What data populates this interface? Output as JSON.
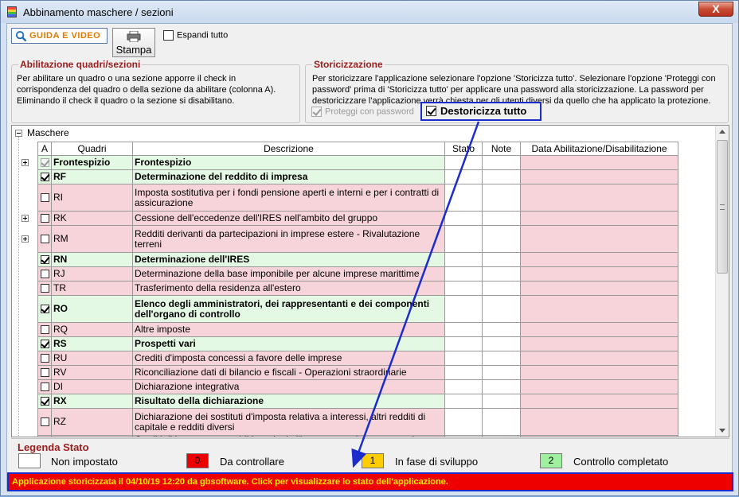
{
  "window": {
    "title": "Abbinamento maschere / sezioni",
    "close_label": "X"
  },
  "toolbar": {
    "guida_label": "GUIDA E VIDEO",
    "stampa_label": "Stampa",
    "espandi_label": "Espandi tutto",
    "espandi_checked": false
  },
  "abilitazione": {
    "title": "Abilitazione quadri/sezioni",
    "text": "Per abilitare un quadro o una sezione apporre il check in corrispondenza del quadro o della sezione da abilitare (colonna A). Eliminando il check il quadro o la sezione si disabilitano."
  },
  "storicizzazione": {
    "title": "Storicizzazione",
    "text": "Per storicizzare l'applicazione selezionare l'opzione 'Storicizza tutto'. Selezionare l'opzione 'Proteggi con password' prima di 'Storicizza tutto' per applicare una password alla storicizzazione. La password per destoricizzare l'applicazione verrà chiesta per gli utenti diversi da quello che ha applicato la protezione.",
    "proteggi_label": "Proteggi con password",
    "destoricizza_label": "Destoricizza tutto"
  },
  "tree": {
    "root_label": "Maschere",
    "columns": [
      "A",
      "Quadri",
      "Descrizione",
      "Stato",
      "Note",
      "Data Abilitazione/Disabilitazione"
    ],
    "rows": [
      {
        "code": "Frontespizio",
        "desc": "Frontespizio",
        "checked": true,
        "disabled": true,
        "style": "green",
        "expander": true,
        "tall": false
      },
      {
        "code": "RF",
        "desc": "Determinazione del reddito di impresa",
        "checked": true,
        "style": "green",
        "expander": false,
        "tall": false
      },
      {
        "code": "RI",
        "desc": "Imposta sostitutiva per i fondi pensione aperti e interni e per i contratti di assicurazione",
        "checked": false,
        "style": "pink",
        "expander": false,
        "tall": true
      },
      {
        "code": "RK",
        "desc": "Cessione dell'eccedenze dell'IRES nell'ambito del gruppo",
        "checked": false,
        "style": "pink",
        "expander": true,
        "tall": false
      },
      {
        "code": "RM",
        "desc": "Redditi derivanti da  partecipazioni in imprese estere - Rivalutazione terreni",
        "checked": false,
        "style": "pink",
        "expander": true,
        "tall": true
      },
      {
        "code": "RN",
        "desc": "Determinazione dell'IRES",
        "checked": true,
        "style": "green",
        "expander": false,
        "tall": false
      },
      {
        "code": "RJ",
        "desc": "Determinazione della base imponibile per alcune imprese marittime",
        "checked": false,
        "style": "pink",
        "expander": false,
        "tall": false
      },
      {
        "code": "TR",
        "desc": "Trasferimento della residenza all'estero",
        "checked": false,
        "style": "pink",
        "expander": false,
        "tall": false
      },
      {
        "code": "RO",
        "desc": "Elenco  degli amministratori, dei rappresentanti e dei componenti dell'organo di controllo",
        "checked": true,
        "style": "green",
        "expander": false,
        "tall": true
      },
      {
        "code": "RQ",
        "desc": "Altre imposte",
        "checked": false,
        "style": "pink",
        "expander": false,
        "tall": false
      },
      {
        "code": "RS",
        "desc": "Prospetti vari",
        "checked": true,
        "style": "green",
        "expander": false,
        "tall": false
      },
      {
        "code": "RU",
        "desc": "Crediti d'imposta concessi a favore delle imprese",
        "checked": false,
        "style": "pink",
        "expander": false,
        "tall": false
      },
      {
        "code": "RV",
        "desc": "Riconciliazione dati di bilancio e fiscali - Operazioni straordinarie",
        "checked": false,
        "style": "pink",
        "expander": false,
        "tall": false
      },
      {
        "code": "DI",
        "desc": "Dichiarazione integrativa",
        "checked": false,
        "style": "pink",
        "expander": false,
        "tall": false
      },
      {
        "code": "RX",
        "desc": "Risultato della dichiarazione",
        "checked": true,
        "style": "green",
        "expander": false,
        "tall": false
      },
      {
        "code": "RZ",
        "desc": "Dichiarazione dei sostituti d'imposta relativa a interessi, altri redditi di capitale e redditi diversi",
        "checked": false,
        "style": "pink",
        "expander": false,
        "tall": true
      },
      {
        "code": "",
        "desc": "Crediti di imposta per redditi prodotti all'estero e per imposte assolte",
        "checked": false,
        "style": "pink",
        "expander": false,
        "tall": false
      }
    ]
  },
  "legend": {
    "title": "Legenda Stato",
    "items": [
      {
        "badge": "",
        "label": "Non impostato",
        "color": "#ffffff"
      },
      {
        "badge": "0",
        "label": "Da controllare",
        "color": "#ee0000"
      },
      {
        "badge": "1",
        "label": "In fase di sviluppo",
        "color": "#ffcc00"
      },
      {
        "badge": "2",
        "label": "Controllo completato",
        "color": "#9ff09f"
      }
    ]
  },
  "status": {
    "text": "Applicazione storicizzata il 04/10/19 12:20 da gbsoftware. Click per visualizzare lo stato dell'applicazione."
  },
  "colors": {
    "highlight_border": "#1a2ccc",
    "row_pink": "#f7d3da",
    "row_green": "#e4f9e4",
    "status_bg": "#ee0000",
    "status_text": "#ffe800",
    "section_title": "#9a1c1c"
  }
}
